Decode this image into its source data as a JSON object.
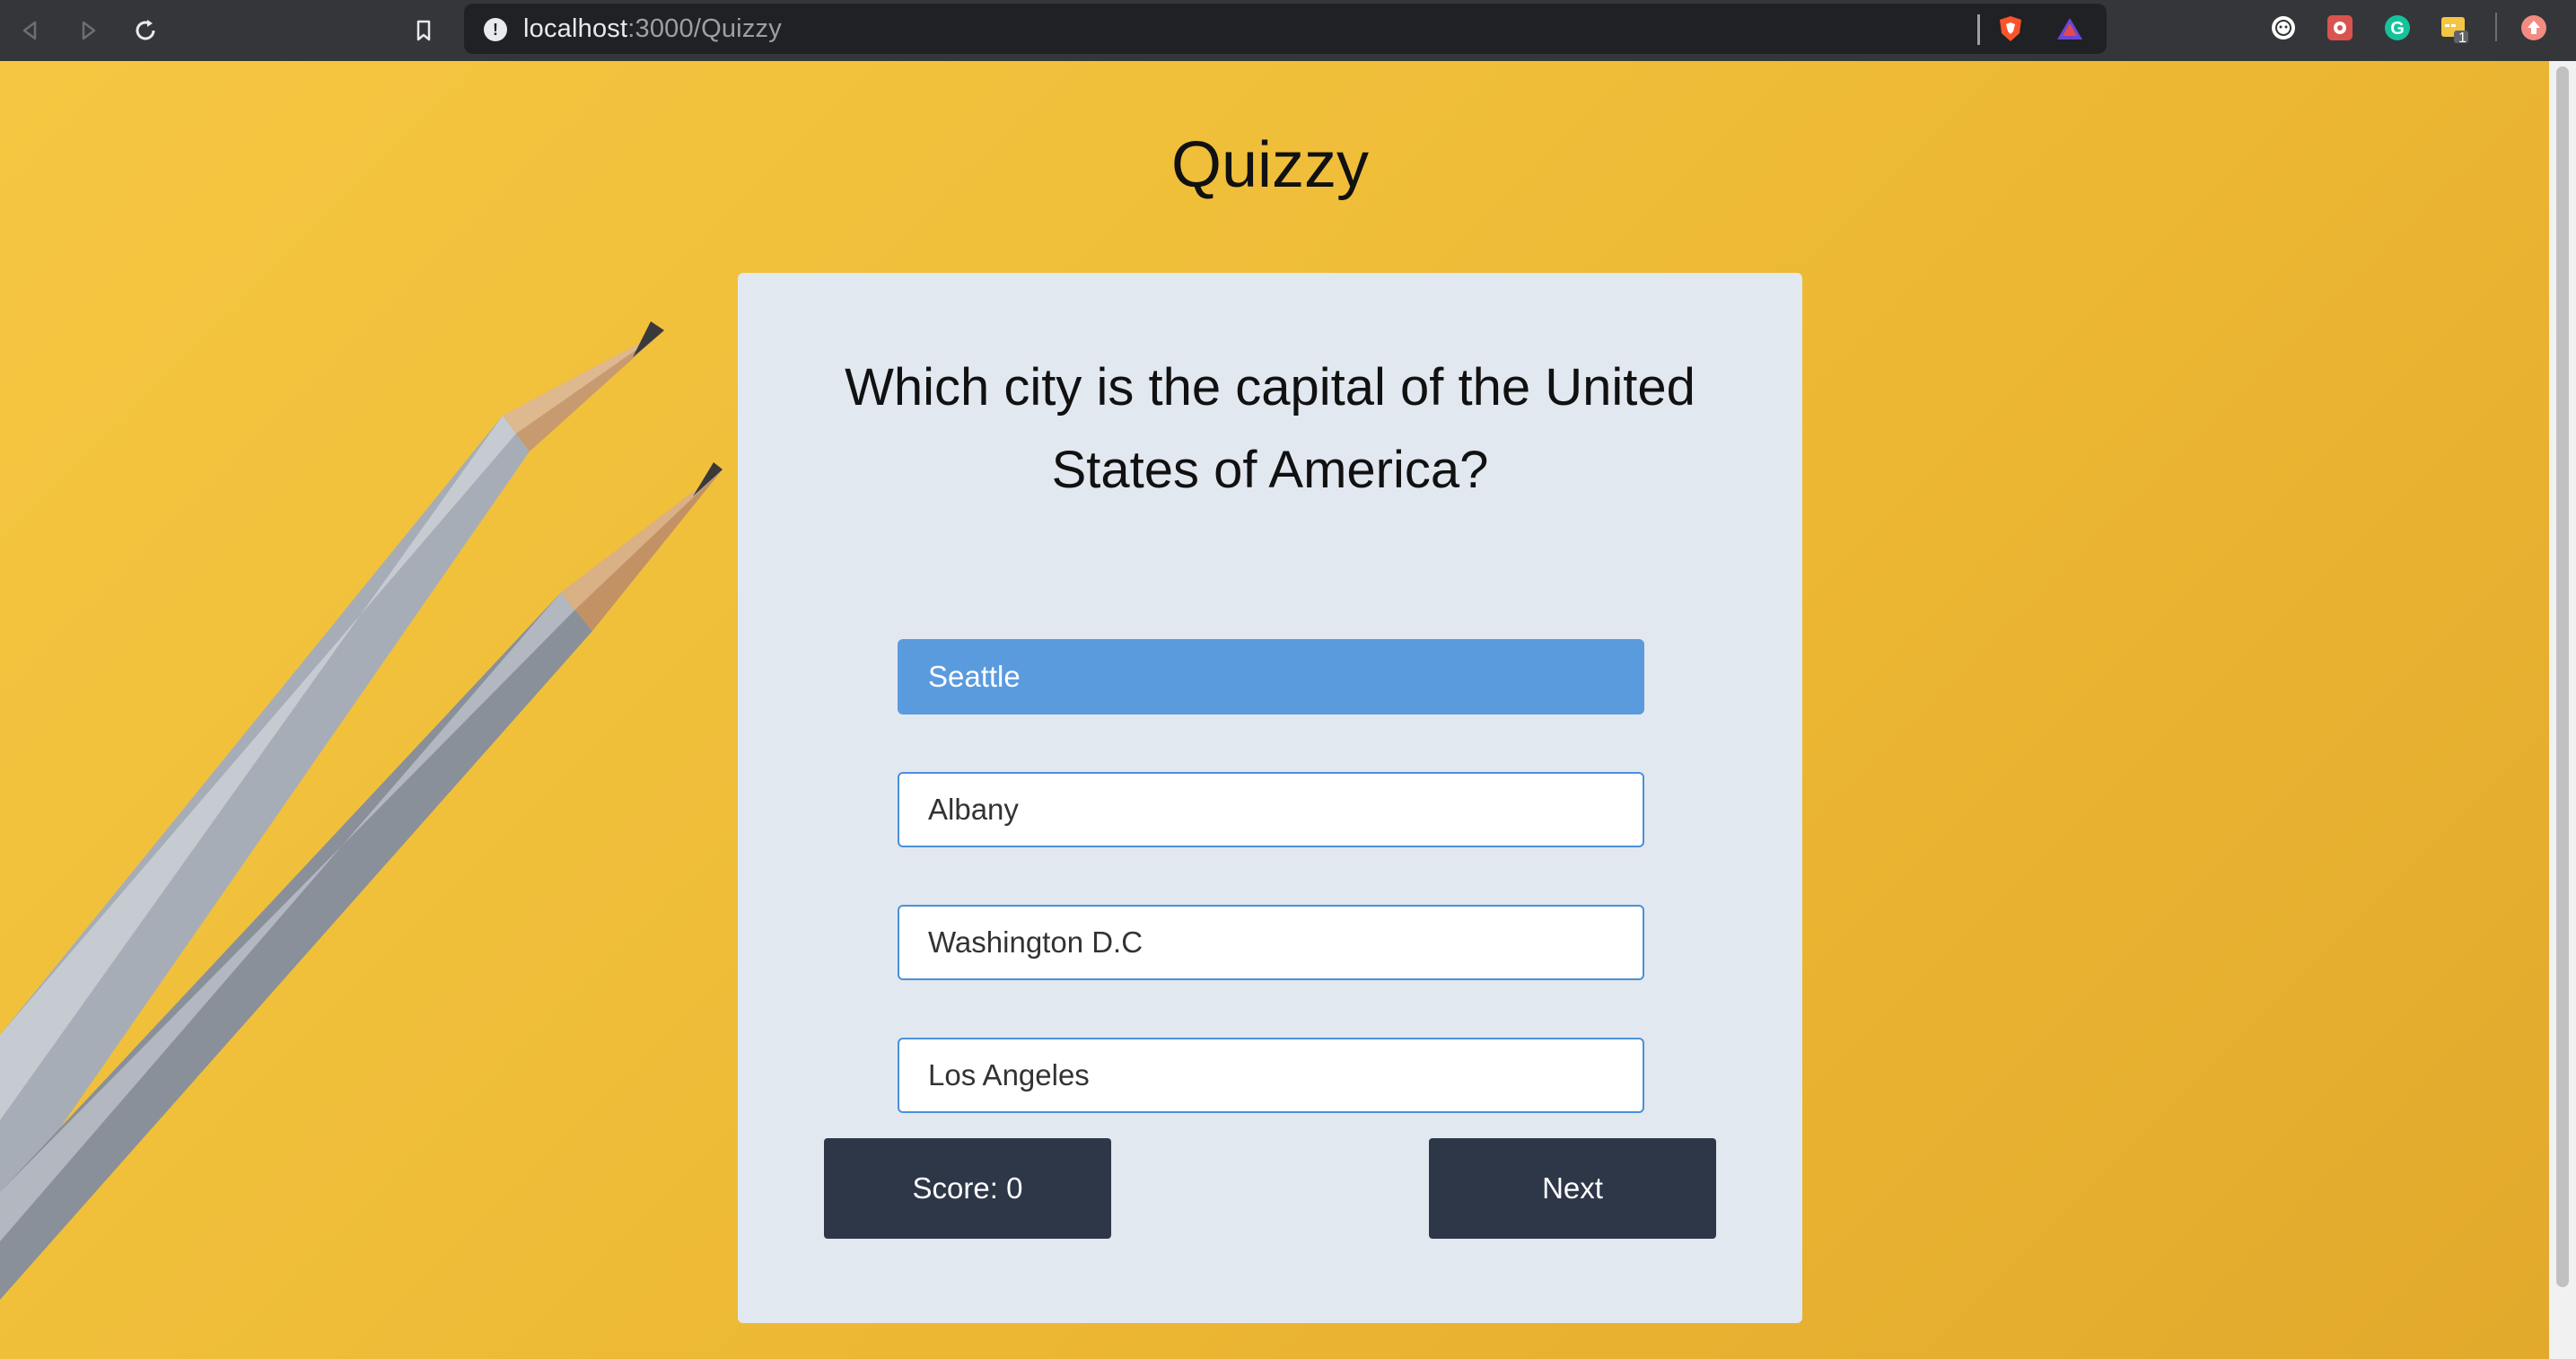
{
  "browser": {
    "url_host": "localhost",
    "url_path": ":3000/Quizzy",
    "extension_badge": "1"
  },
  "page": {
    "title": "Quizzy"
  },
  "quiz": {
    "question": "Which city is the capital of the United States of America?",
    "answers": [
      {
        "label": "Seattle",
        "selected": true
      },
      {
        "label": "Albany",
        "selected": false
      },
      {
        "label": "Washington D.C",
        "selected": false
      },
      {
        "label": "Los Angeles",
        "selected": false
      }
    ],
    "score_label": "Score: 0",
    "next_label": "Next"
  },
  "colors": {
    "background": "#f0bf3a",
    "card": "#e2e8f0",
    "selected_answer": "#5a9bde",
    "answer_border": "#4a90d9",
    "button_dark": "#2d3748"
  },
  "icons": [
    "back-icon",
    "forward-icon",
    "reload-icon",
    "bookmark-icon",
    "site-info-icon",
    "brave-shield-icon",
    "brave-rewards-icon",
    "extension-icon",
    "extension-red-icon",
    "grammarly-icon",
    "extension-yellow-icon",
    "profile-icon"
  ]
}
